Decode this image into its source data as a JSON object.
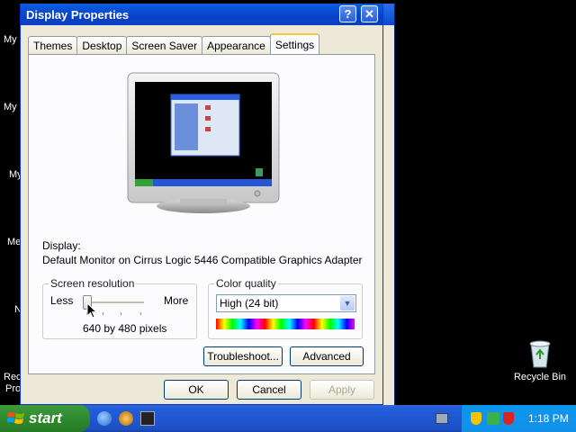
{
  "window": {
    "title": "Display Properties",
    "help_label": "?",
    "close_label": "✕"
  },
  "tabs": [
    "Themes",
    "Desktop",
    "Screen Saver",
    "Appearance",
    "Settings"
  ],
  "active_tab": "Settings",
  "display": {
    "label": "Display:",
    "value": "Default Monitor on Cirrus Logic 5446 Compatible Graphics Adapter"
  },
  "resolution": {
    "group_label": "Screen resolution",
    "less_label": "Less",
    "more_label": "More",
    "value_text": "640 by 480 pixels",
    "slider_position": 0
  },
  "color_quality": {
    "group_label": "Color quality",
    "selected": "High (24 bit)"
  },
  "buttons": {
    "troubleshoot": "Troubleshoot...",
    "advanced": "Advanced",
    "ok": "OK",
    "cancel": "Cancel",
    "apply": "Apply"
  },
  "desktop": {
    "left_labels": [
      "My",
      "My",
      "My",
      "Me",
      "N",
      "Rec",
      "Pro"
    ],
    "recycle_bin_label": "Recycle Bin"
  },
  "taskbar": {
    "start_label": "start",
    "clock": "1:18 PM"
  },
  "colors": {
    "titlebar": "#0842c8",
    "start_green": "#2f8a2f",
    "taskbar_blue": "#245edb",
    "tab_highlight": "#ffc73c"
  }
}
